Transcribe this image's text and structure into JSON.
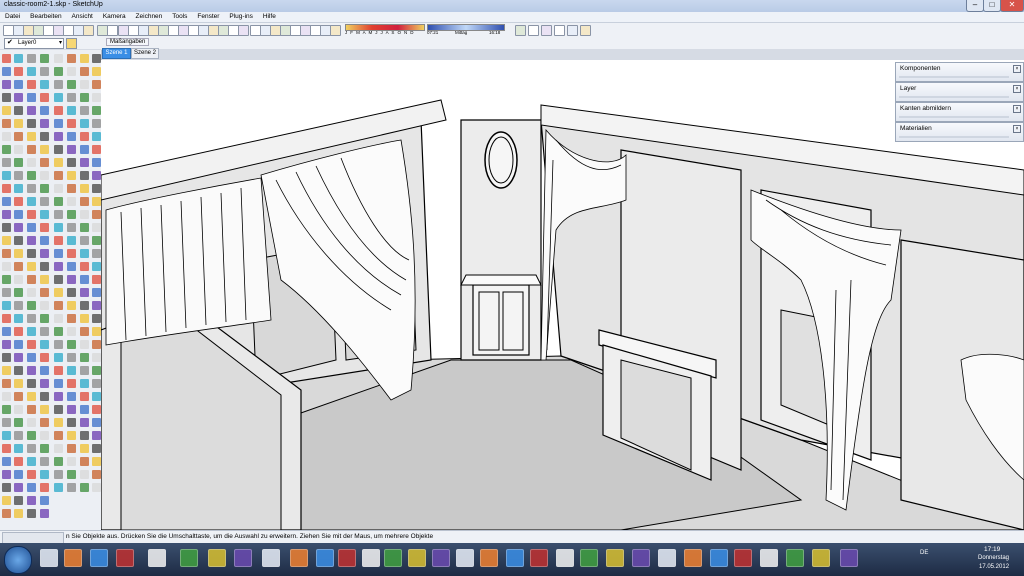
{
  "window": {
    "title": "classic-room2-1.skp - SketchUp"
  },
  "menu": [
    "Datei",
    "Bearbeiten",
    "Ansicht",
    "Kamera",
    "Zeichnen",
    "Tools",
    "Fenster",
    "Plug-ins",
    "Hilfe"
  ],
  "layer": {
    "label": "Layer0"
  },
  "shadow": {
    "months": "J F M A M J J A S O N D",
    "time_start": "07:21",
    "label_mid": "Mittag",
    "time_end": "16:18"
  },
  "tabs": {
    "group_label": "Maßangaben",
    "scenes": [
      "Szene 1",
      "Szene 2"
    ]
  },
  "right_panels": [
    "Komponenten",
    "Layer",
    "Kanten abmildern",
    "Materialien"
  ],
  "status": {
    "text": "n Sie Objekte aus. Drücken Sie die Umschalttaste, um die Auswahl zu erweitern. Ziehen Sie mit der Maus, um mehrere Objekte"
  },
  "taskbar": {
    "lang": "DE",
    "time": "17:19",
    "day": "Donnerstag",
    "date": "17.05.2012"
  },
  "colors": {
    "selected_tab": "#3a8ee6",
    "taskbar": "#233553"
  }
}
